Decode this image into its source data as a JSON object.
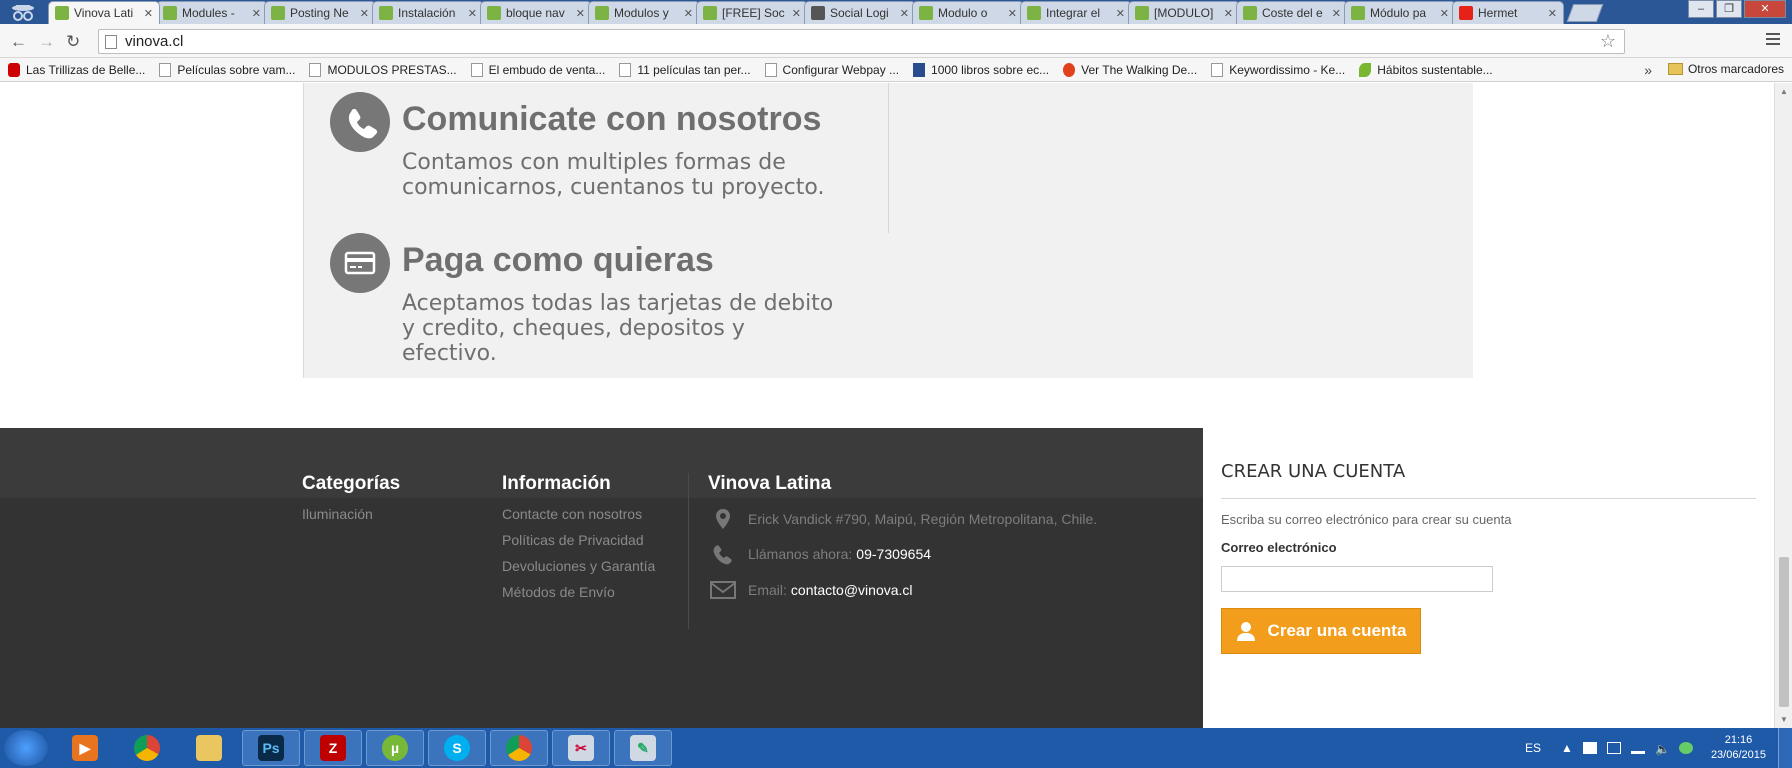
{
  "browser": {
    "tabs": [
      {
        "label": "Vinova Lati",
        "color": "#7cb342"
      },
      {
        "label": "Modules -",
        "color": "#7cb342"
      },
      {
        "label": "Posting Ne",
        "color": "#7cb342"
      },
      {
        "label": "Instalación",
        "color": "#7cb342"
      },
      {
        "label": "bloque nav",
        "color": "#7cb342"
      },
      {
        "label": "Modulos y",
        "color": "#7cb342"
      },
      {
        "label": "[FREE] Soc",
        "color": "#7cb342"
      },
      {
        "label": "Social Logi",
        "color": "#555555"
      },
      {
        "label": "Modulo o",
        "color": "#7cb342"
      },
      {
        "label": "Integrar el",
        "color": "#7cb342"
      },
      {
        "label": "[MODULO]",
        "color": "#7cb342"
      },
      {
        "label": "Coste del e",
        "color": "#7cb342"
      },
      {
        "label": "Módulo pa",
        "color": "#7cb342"
      },
      {
        "label": "Hermet",
        "color": "#e62117"
      }
    ],
    "url": "vinova.cl",
    "bookmarks": [
      {
        "label": "Las Trillizas de Belle...",
        "icon": "yt"
      },
      {
        "label": "Películas sobre vam...",
        "icon": "page"
      },
      {
        "label": "MODULOS PRESTAS...",
        "icon": "page"
      },
      {
        "label": "El embudo de venta...",
        "icon": "page"
      },
      {
        "label": "11 películas tan per...",
        "icon": "page"
      },
      {
        "label": "Configurar Webpay ...",
        "icon": "page"
      },
      {
        "label": "1000 libros sobre ec...",
        "icon": "gpc"
      },
      {
        "label": "Ver The Walking De...",
        "icon": "wd"
      },
      {
        "label": "Keywordissimo - Ke...",
        "icon": "page"
      },
      {
        "label": "Hábitos sustentable...",
        "icon": "leaf"
      }
    ],
    "more": "»",
    "other_bookmarks": "Otros marcadores"
  },
  "features": [
    {
      "title": "Comunicate con nosotros",
      "text": "Contamos con multiples formas de comunicarnos, cuentanos tu proyecto.",
      "icon": "phone-icon"
    },
    {
      "title": "Paga como quieras",
      "text": "Aceptamos todas las tarjetas de debito y credito, cheques, depositos y efectivo.",
      "icon": "credit-card-icon"
    }
  ],
  "footer": {
    "categories": {
      "title": "Categorías",
      "items": [
        "Iluminación"
      ]
    },
    "information": {
      "title": "Información",
      "items": [
        "Contacte con nosotros",
        "Políticas de Privacidad",
        "Devoluciones y Garantía",
        "Métodos de Envío"
      ]
    },
    "company": {
      "title": "Vinova Latina",
      "address": "Erick Vandick #790, Maipú, Región Metropolitana, Chile.",
      "phone_label": "Llámanos ahora:",
      "phone": "09-7309654",
      "email_label": "Email:",
      "email": "contacto@vinova.cl"
    },
    "signup": {
      "title": "CREAR UNA CUENTA",
      "description": "Escriba su correo electrónico para crear su cuenta",
      "email_label": "Correo electrónico",
      "email_value": "",
      "button": "Crear una cuenta",
      "accent": "#f39d1c"
    }
  },
  "taskbar": {
    "apps": [
      "media-player",
      "chrome",
      "explorer",
      "photoshop",
      "filezilla",
      "utorrent",
      "skype",
      "chrome",
      "snipping-tool",
      "paint"
    ],
    "lang": "ES",
    "time": "21:16",
    "date": "23/06/2015"
  }
}
